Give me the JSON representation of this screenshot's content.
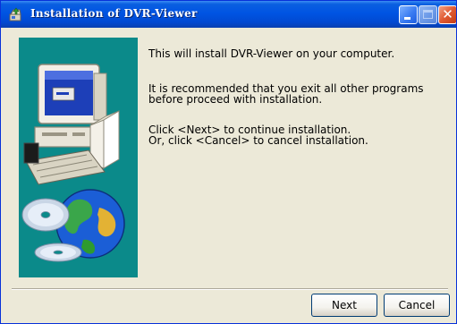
{
  "window": {
    "title": "Installation of DVR-Viewer",
    "controls": {
      "close_glyph": "✕"
    }
  },
  "content": {
    "line1": "This will install DVR-Viewer on your computer.",
    "line2": "It is recommended that you exit all other programs",
    "line3": "before proceed with installation.",
    "line4": "Click <Next> to continue installation.",
    "line5": "Or, click <Cancel> to cancel installation."
  },
  "buttons": {
    "next_label": "Next",
    "cancel_label": "Cancel"
  },
  "icons": {
    "app": "installer-icon",
    "illustration": "computer-and-globe-with-cds"
  },
  "colors": {
    "title_bar": "#0054e3",
    "panel": "#0b8a8a",
    "dialog_bg": "#ece9d8"
  }
}
